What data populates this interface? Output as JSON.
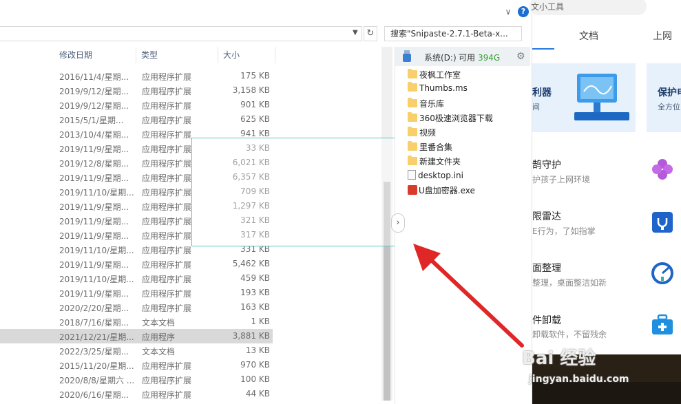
{
  "explorer": {
    "search_text": "搜索\"Snipaste-2.7.1-Beta-x...",
    "columns": {
      "date": "修改日期",
      "type": "类型",
      "size": "大小"
    },
    "rows": [
      {
        "date": "2016/11/4/星期...",
        "type": "应用程序扩展",
        "size": "175 KB"
      },
      {
        "date": "2019/9/12/星期...",
        "type": "应用程序扩展",
        "size": "3,158 KB"
      },
      {
        "date": "2019/9/12/星期...",
        "type": "应用程序扩展",
        "size": "901 KB"
      },
      {
        "date": "2015/5/1/星期...",
        "type": "应用程序扩展",
        "size": "625 KB"
      },
      {
        "date": "2013/10/4/星期...",
        "type": "应用程序扩展",
        "size": "941 KB"
      },
      {
        "date": "2019/11/9/星期...",
        "type": "应用程序扩展",
        "size": "33 KB"
      },
      {
        "date": "2019/12/8/星期...",
        "type": "应用程序扩展",
        "size": "6,021 KB"
      },
      {
        "date": "2019/11/9/星期...",
        "type": "应用程序扩展",
        "size": "6,357 KB"
      },
      {
        "date": "2019/11/10/星期...",
        "type": "应用程序扩展",
        "size": "709 KB"
      },
      {
        "date": "2019/11/9/星期...",
        "type": "应用程序扩展",
        "size": "1,297 KB"
      },
      {
        "date": "2019/11/9/星期...",
        "type": "应用程序扩展",
        "size": "321 KB"
      },
      {
        "date": "2019/11/9/星期...",
        "type": "应用程序扩展",
        "size": "317 KB"
      },
      {
        "date": "2019/11/10/星期...",
        "type": "应用程序扩展",
        "size": "331 KB"
      },
      {
        "date": "2019/11/9/星期...",
        "type": "应用程序扩展",
        "size": "5,462 KB"
      },
      {
        "date": "2019/11/10/星期...",
        "type": "应用程序扩展",
        "size": "459 KB"
      },
      {
        "date": "2019/11/9/星期...",
        "type": "应用程序扩展",
        "size": "193 KB"
      },
      {
        "date": "2020/2/20/星期...",
        "type": "应用程序扩展",
        "size": "163 KB"
      },
      {
        "date": "2018/7/16/星期...",
        "type": "文本文档",
        "size": "1 KB"
      },
      {
        "date": "2021/12/21/星期...",
        "type": "应用程序",
        "size": "3,881 KB",
        "selected": true
      },
      {
        "date": "2022/3/25/星期...",
        "type": "文本文档",
        "size": "13 KB"
      },
      {
        "date": "2015/11/20/星期...",
        "type": "应用程序扩展",
        "size": "970 KB"
      },
      {
        "date": "2020/8/8/星期六 ...",
        "type": "应用程序扩展",
        "size": "100 KB"
      },
      {
        "date": "2020/6/16/星期...",
        "type": "应用程序扩展",
        "size": "44 KB"
      }
    ]
  },
  "drive_panel": {
    "drive_name": "系统(D:)",
    "free_label": "可用",
    "free_value": "394G",
    "items": [
      {
        "name": "夜枫工作室",
        "kind": "folder"
      },
      {
        "name": "Thumbs.ms",
        "kind": "folder"
      },
      {
        "name": "音乐库",
        "kind": "folder"
      },
      {
        "name": "360极速浏览器下载",
        "kind": "folder"
      },
      {
        "name": "视频",
        "kind": "folder"
      },
      {
        "name": "里番合集",
        "kind": "folder"
      },
      {
        "name": "新建文件夹",
        "kind": "folder"
      },
      {
        "name": "desktop.ini",
        "kind": "ini"
      },
      {
        "name": "U盘加密器.exe",
        "kind": "exe"
      }
    ]
  },
  "tools": {
    "search_text": "文小工具",
    "tabs": [
      "文档",
      "上网"
    ],
    "banner1": {
      "title": "利器",
      "sub": "间"
    },
    "banner2": {
      "title": "保护电",
      "sub": "全方位"
    },
    "items": [
      {
        "title": "鹄守护",
        "desc": "护孩子上网环境"
      },
      {
        "title": "限雷达",
        "desc": "E行为，了如指掌"
      },
      {
        "title": "面整理",
        "desc": "整理，桌面整洁如新"
      },
      {
        "title": "件卸载",
        "desc": "卸载软件，不留残余"
      }
    ]
  },
  "watermark": {
    "main": "Bai 经验",
    "url": "jingyan.baidu.com"
  },
  "colors": {
    "accent": "#2a7ae2",
    "free_space": "#2fa02f",
    "arrow": "#e02727",
    "snip_border": "#57c2c7"
  }
}
